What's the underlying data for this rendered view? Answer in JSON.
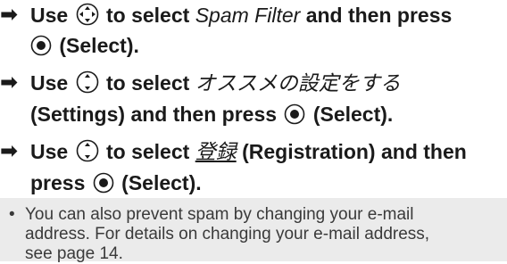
{
  "steps": [
    {
      "arrow": "➡",
      "icon": "dpad-four-way-icon",
      "p1": "Use",
      "p2": "to select",
      "target": "Spam Filter",
      "p3": "and then press",
      "p4": "(Select)."
    },
    {
      "arrow": "➡",
      "icon": "dpad-up-down-icon",
      "p1": "Use",
      "p2": "to select",
      "target": "オススメの設定をする",
      "p3": "(Settings) and then press",
      "p4": "(Select)."
    },
    {
      "arrow": "➡",
      "icon": "dpad-up-down-icon",
      "p1": "Use",
      "p2": "to select",
      "target": "登録",
      "p3": "(Registration) and then",
      "p4": "press",
      "p5": "(Select)."
    }
  ],
  "note": {
    "bullet": "•",
    "line1": "You can also prevent spam by changing your e-mail",
    "line2": "address. For details on changing your e-mail address,",
    "line3": "see page 14."
  },
  "colors": {
    "text": "#1a1a1a",
    "note_background": "#ebebeb",
    "note_text": "#3a3a3a"
  }
}
